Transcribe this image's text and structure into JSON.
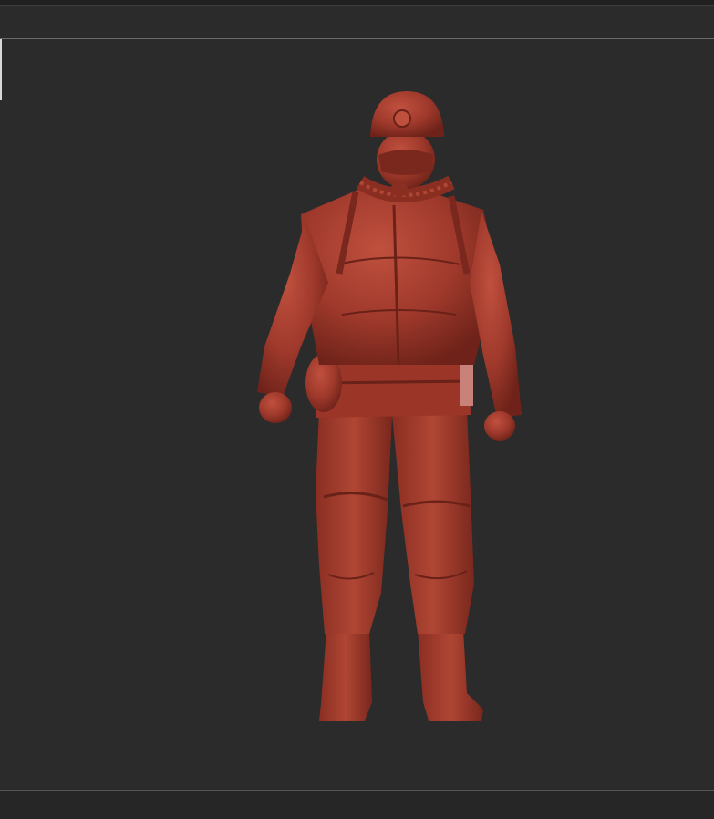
{
  "canvas": {
    "background": "#2b2b2b",
    "model_color": "#a03a2c",
    "model_subject": "miner-figure-sculpt"
  }
}
